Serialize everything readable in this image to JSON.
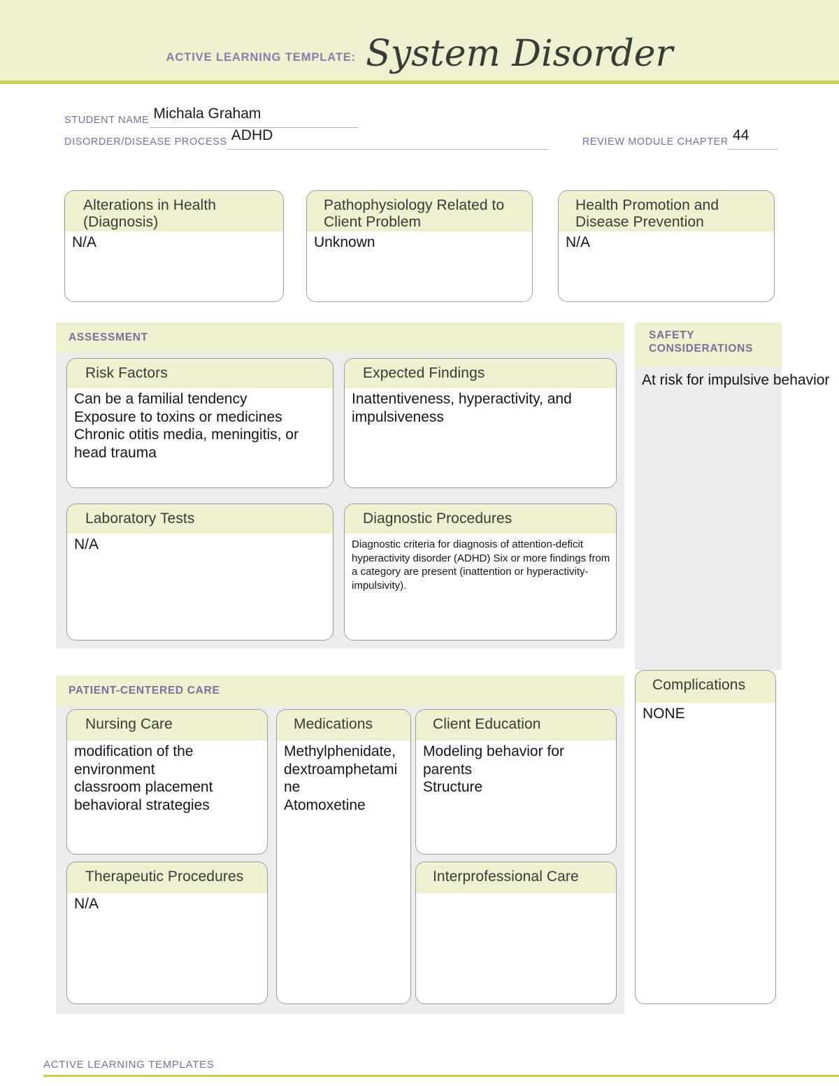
{
  "header": {
    "label": "ACTIVE LEARNING TEMPLATE:",
    "title": "System Disorder"
  },
  "form": {
    "student_name_label": "STUDENT NAME",
    "student_name_value": "Michala Graham",
    "disorder_label": "DISORDER/DISEASE PROCESS",
    "disorder_value": "ADHD",
    "chapter_label": "REVIEW MODULE CHAPTER",
    "chapter_value": "44"
  },
  "top_boxes": [
    {
      "title": "Alterations in\nHealth (Diagnosis)",
      "content": "N/A"
    },
    {
      "title": "Pathophysiology Related\nto Client Problem",
      "content": "Unknown"
    },
    {
      "title": "Health Promotion and\nDisease Prevention",
      "content": "N/A"
    }
  ],
  "assessment": {
    "section_title": "ASSESSMENT",
    "boxes": [
      {
        "title": "Risk Factors",
        "content": "Can be a familial tendency\nExposure to toxins or medicines\nChronic otitis media, meningitis, or\nhead trauma"
      },
      {
        "title": "Expected Findings",
        "content": "Inattentiveness, hyperactivity, and\nimpulsiveness"
      },
      {
        "title": "Laboratory Tests",
        "content": "N/A"
      },
      {
        "title": "Diagnostic Procedures",
        "content": "Diagnostic criteria for diagnosis of attention-deficit hyperactivity disorder (ADHD) Six or more findings from a category are present (inattention or hyperactivity-impulsivity)."
      }
    ]
  },
  "safety": {
    "section_title": "SAFETY\nCONSIDERATIONS",
    "content": "At risk for\nimpulsive behavior"
  },
  "complications": {
    "title": "Complications",
    "content": "NONE"
  },
  "patient_centered_care": {
    "section_title": "PATIENT-CENTERED CARE",
    "boxes": [
      {
        "title": "Nursing Care",
        "content": "modification of the environment\nclassroom placement\nbehavioral strategies"
      },
      {
        "title": "Medications",
        "content": "Methylphenidate,\ndextroamphetamine\nAtomoxetine"
      },
      {
        "title": "Client Education",
        "content": "Modeling behavior for parents\nStructure"
      },
      {
        "title": "Therapeutic Procedures",
        "content": "N/A"
      },
      {
        "title": "Interprofessional Care",
        "content": ""
      }
    ]
  },
  "footer": {
    "text": "ACTIVE LEARNING TEMPLATES"
  }
}
